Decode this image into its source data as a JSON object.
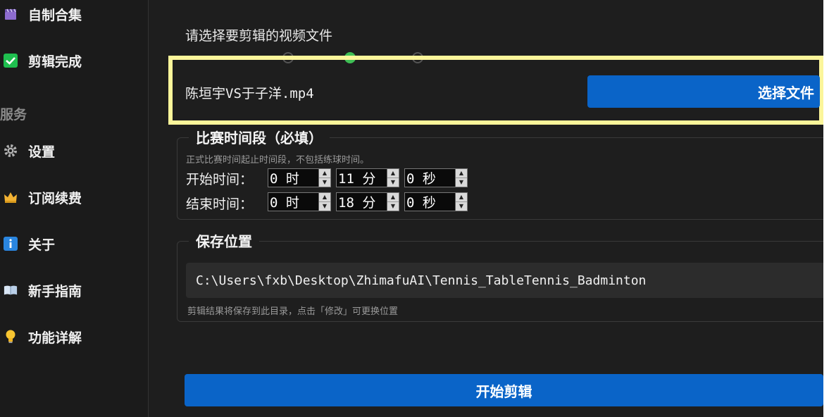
{
  "sidebar": {
    "items": [
      {
        "label": "自制合集",
        "icon": "clapperboard-icon"
      },
      {
        "label": "剪辑完成",
        "icon": "checkmark-icon"
      }
    ],
    "section_label": "服务",
    "service_items": [
      {
        "label": "设置",
        "icon": "gear-icon"
      },
      {
        "label": "订阅续费",
        "icon": "crown-icon"
      },
      {
        "label": "关于",
        "icon": "info-icon"
      },
      {
        "label": "新手指南",
        "icon": "book-icon"
      },
      {
        "label": "功能详解",
        "icon": "lightbulb-icon"
      }
    ]
  },
  "file_select": {
    "prompt": "请选择要剪辑的视频文件",
    "filename": "陈垣宇VS于子洋.mp4",
    "button_label": "选择文件"
  },
  "match_time": {
    "title": "比赛时间段（必填）",
    "hint": "正式比赛时间起止时间段，不包括练球时间。",
    "start_label": "开始时间：",
    "end_label": "结束时间：",
    "start": {
      "h": "0 时",
      "m": "11 分",
      "s": "0 秒"
    },
    "end": {
      "h": "0 时",
      "m": "18 分",
      "s": "0 秒"
    }
  },
  "save": {
    "title": "保存位置",
    "path": "C:\\Users\\fxb\\Desktop\\ZhimafuAI\\Tennis_TableTennis_Badminton",
    "hint": "剪辑结果将保存到此目录，点击「修改」可更换位置"
  },
  "start_button_label": "开始剪辑",
  "colors": {
    "accent": "#0a64c8",
    "highlight": "#fbf59a",
    "radio_on": "#3fbf55"
  }
}
